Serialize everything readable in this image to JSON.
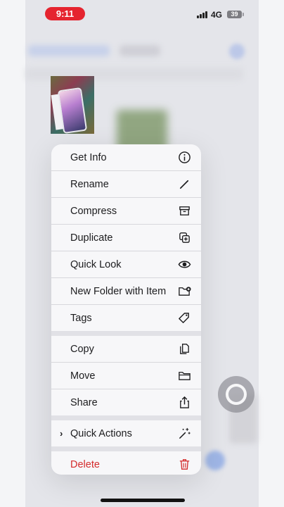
{
  "status": {
    "time": "9:11",
    "network": "4G",
    "battery": "39"
  },
  "menu": {
    "group1": [
      {
        "label": "Get Info",
        "icon": "info-icon"
      },
      {
        "label": "Rename",
        "icon": "pencil-icon"
      },
      {
        "label": "Compress",
        "icon": "archive-box-icon"
      },
      {
        "label": "Duplicate",
        "icon": "duplicate-icon"
      },
      {
        "label": "Quick Look",
        "icon": "eye-icon"
      },
      {
        "label": "New Folder with Item",
        "icon": "folder-badge-plus-icon"
      },
      {
        "label": "Tags",
        "icon": "tag-icon"
      }
    ],
    "group2": [
      {
        "label": "Copy",
        "icon": "copy-icon"
      },
      {
        "label": "Move",
        "icon": "folder-icon"
      },
      {
        "label": "Share",
        "icon": "share-icon"
      }
    ],
    "group3": [
      {
        "label": "Quick Actions",
        "icon": "sparkles-icon"
      }
    ],
    "group4": [
      {
        "label": "Delete",
        "icon": "trash-icon"
      }
    ]
  },
  "colors": {
    "destructive": "#d42b2b",
    "status_pill": "#e5242f"
  }
}
